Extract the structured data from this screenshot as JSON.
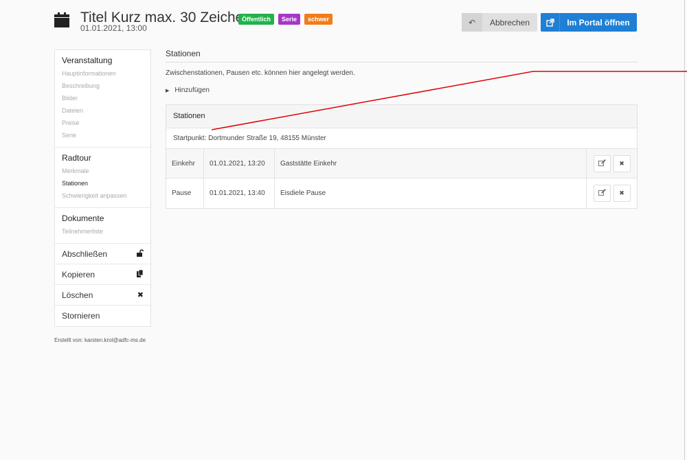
{
  "header": {
    "title": "Titel Kurz max. 30 Zeichen",
    "subtitle": "01.01.2021, 13:00",
    "badges": [
      {
        "label": "Öffentlich",
        "color": "#22b24c"
      },
      {
        "label": "Serie",
        "color": "#a637c9"
      },
      {
        "label": "schwer",
        "color": "#f07d1a"
      }
    ],
    "cancel_label": "Abbrechen",
    "portal_label": "Im Portal öffnen"
  },
  "sidebar": {
    "sections": [
      {
        "title": "Veranstaltung",
        "items": [
          "Hauptinformationen",
          "Beschreibung",
          "Bilder",
          "Dateien",
          "Preise",
          "Serie"
        ]
      },
      {
        "title": "Radtour",
        "items": [
          "Merkmale",
          "Stationen",
          "Schwierigkeit anpassen"
        ],
        "active": "Stationen"
      },
      {
        "title": "Dokumente",
        "items": [
          "Teilnehmerliste"
        ]
      }
    ],
    "actions": [
      {
        "label": "Abschließen",
        "icon": "lock-open-icon"
      },
      {
        "label": "Kopieren",
        "icon": "copy-icon"
      },
      {
        "label": "Löschen",
        "icon": "close-icon"
      },
      {
        "label": "Stornieren",
        "icon": ""
      }
    ],
    "created_by": "Erstellt von: karsten.krol@adfc-ms.de"
  },
  "main": {
    "title": "Stationen",
    "description": "Zwischenstationen, Pausen etc. können hier angelegt werden.",
    "add_label": "Hinzufügen",
    "panel": {
      "header": "Stationen",
      "start": "Startpunkt: Dortmunder Straße 19, 48155 Münster",
      "rows": [
        {
          "type": "Einkehr",
          "time": "01.01.2021, 13:20",
          "name": "Gaststätte Einkehr"
        },
        {
          "type": "Pause",
          "time": "01.01.2021, 13:40",
          "name": "Eisdiele Pause"
        }
      ]
    }
  },
  "colors": {
    "accent": "#1e7fd4",
    "annotation_line": "#e00000"
  }
}
